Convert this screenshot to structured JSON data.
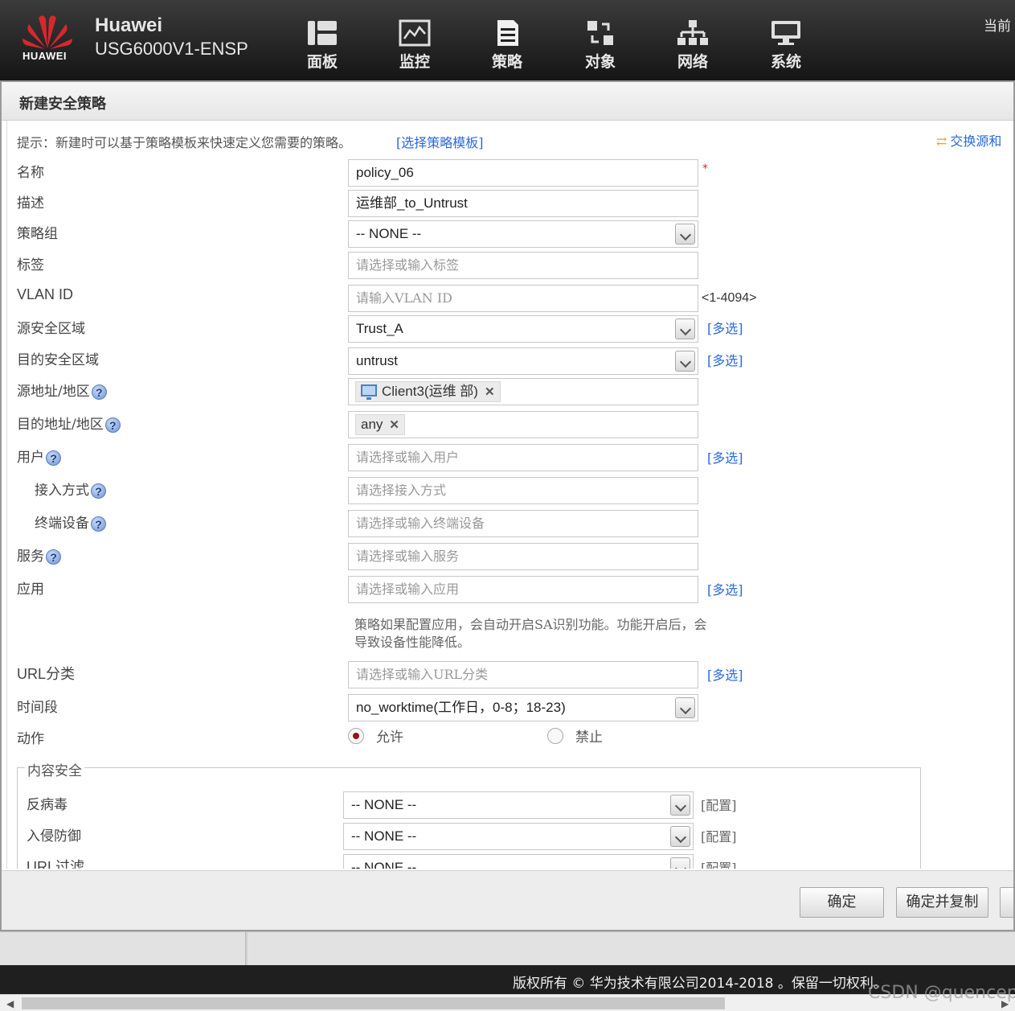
{
  "header": {
    "logo_text": "HUAWEI",
    "brand": "Huawei",
    "model": "USG6000V1-ENSP",
    "nav": [
      {
        "label": "面板",
        "icon": "dashboard-icon"
      },
      {
        "label": "监控",
        "icon": "monitor-chart-icon"
      },
      {
        "label": "策略",
        "icon": "policy-document-icon"
      },
      {
        "label": "对象",
        "icon": "object-icon"
      },
      {
        "label": "网络",
        "icon": "network-icon"
      },
      {
        "label": "系统",
        "icon": "system-computer-icon"
      }
    ],
    "current_user": "当前"
  },
  "dialog": {
    "title": "新建安全策略",
    "hint": "提示：新建时可以基于策略模板来快速定义您需要的策略。",
    "hint_link": "[选择策略模板]",
    "swap_link": "交换源和",
    "fields": {
      "name": {
        "label": "名称",
        "value": "policy_06",
        "required_mark": "*"
      },
      "description": {
        "label": "描述",
        "value": "运维部_to_Untrust"
      },
      "policy_group": {
        "label": "策略组",
        "value": "-- NONE --"
      },
      "tag": {
        "label": "标签",
        "placeholder": "请选择或输入标签"
      },
      "vlan_id": {
        "label": "VLAN ID",
        "placeholder": "请输入VLAN ID",
        "range": "<1-4094>"
      },
      "source_zone": {
        "label": "源安全区域",
        "value": "Trust_A",
        "multi": "[多选]"
      },
      "dest_zone": {
        "label": "目的安全区域",
        "value": "untrust",
        "multi": "[多选]"
      },
      "source_address": {
        "label": "源地址/地区",
        "tag": "Client3(运维 部)"
      },
      "dest_address": {
        "label": "目的地址/地区",
        "tag": "any"
      },
      "user": {
        "label": "用户",
        "placeholder": "请选择或输入用户",
        "multi": "[多选]"
      },
      "access_mode": {
        "label": "接入方式",
        "placeholder": "请选择接入方式"
      },
      "terminal_device": {
        "label": "终端设备",
        "placeholder": "请选择或输入终端设备"
      },
      "service": {
        "label": "服务",
        "placeholder": "请选择或输入服务"
      },
      "application": {
        "label": "应用",
        "placeholder": "请选择或输入应用",
        "multi": "[多选]",
        "note": "策略如果配置应用，会自动开启SA识别功能。功能开启后，会导致设备性能降低。"
      },
      "url_category": {
        "label": "URL分类",
        "placeholder": "请选择或输入URL分类",
        "multi": "[多选]"
      },
      "time_range": {
        "label": "时间段",
        "value": "no_worktime(工作日，0-8；18-23)"
      },
      "action": {
        "label": "动作",
        "options": [
          "允许",
          "禁止"
        ],
        "selected": "允许"
      }
    },
    "content_security": {
      "legend": "内容安全",
      "rows": [
        {
          "label": "反病毒",
          "value": "-- NONE --",
          "config": "[配置]"
        },
        {
          "label": "入侵防御",
          "value": "-- NONE --",
          "config": "[配置]"
        },
        {
          "label": "URL过滤",
          "value": "-- NONE --",
          "config": "[配置]"
        }
      ]
    },
    "buttons": {
      "ok": "确定",
      "ok_copy": "确定并复制"
    }
  },
  "footer": {
    "copyright": "版权所有 © 华为技术有限公司2014-2018 。保留一切权利。",
    "watermark": "CSDN @quencep"
  },
  "colors": {
    "link": "#2a6ad8",
    "header_bg": "#1f1f1f",
    "brand_red": "#d8272e",
    "required": "#d32b2b"
  }
}
